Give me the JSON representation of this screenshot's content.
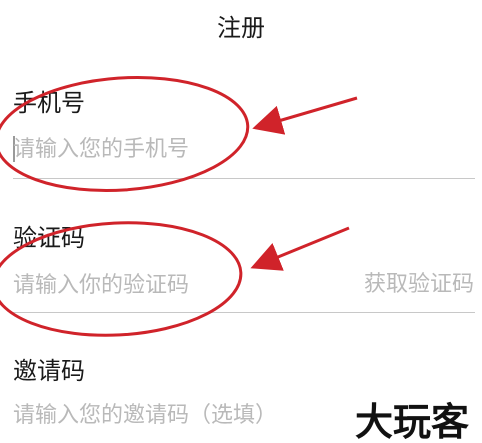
{
  "header": {
    "title": "注册"
  },
  "form": {
    "phone": {
      "label": "手机号",
      "placeholder": "请输入您的手机号",
      "value": ""
    },
    "code": {
      "label": "验证码",
      "placeholder": "请输入你的验证码",
      "value": "",
      "get_code_label": "获取验证码"
    },
    "invite": {
      "label": "邀请码",
      "placeholder": "请输入您的邀请码（选填）",
      "value": ""
    }
  },
  "annotations": {
    "color": "#d0232a",
    "shapes": [
      "ellipse-highlight",
      "arrow"
    ]
  },
  "watermark": {
    "text": "大玩客",
    "color": "#111111"
  },
  "colors": {
    "placeholder": "#b9b9b9",
    "divider": "#c8c8c8",
    "text": "#1a1a1a"
  }
}
